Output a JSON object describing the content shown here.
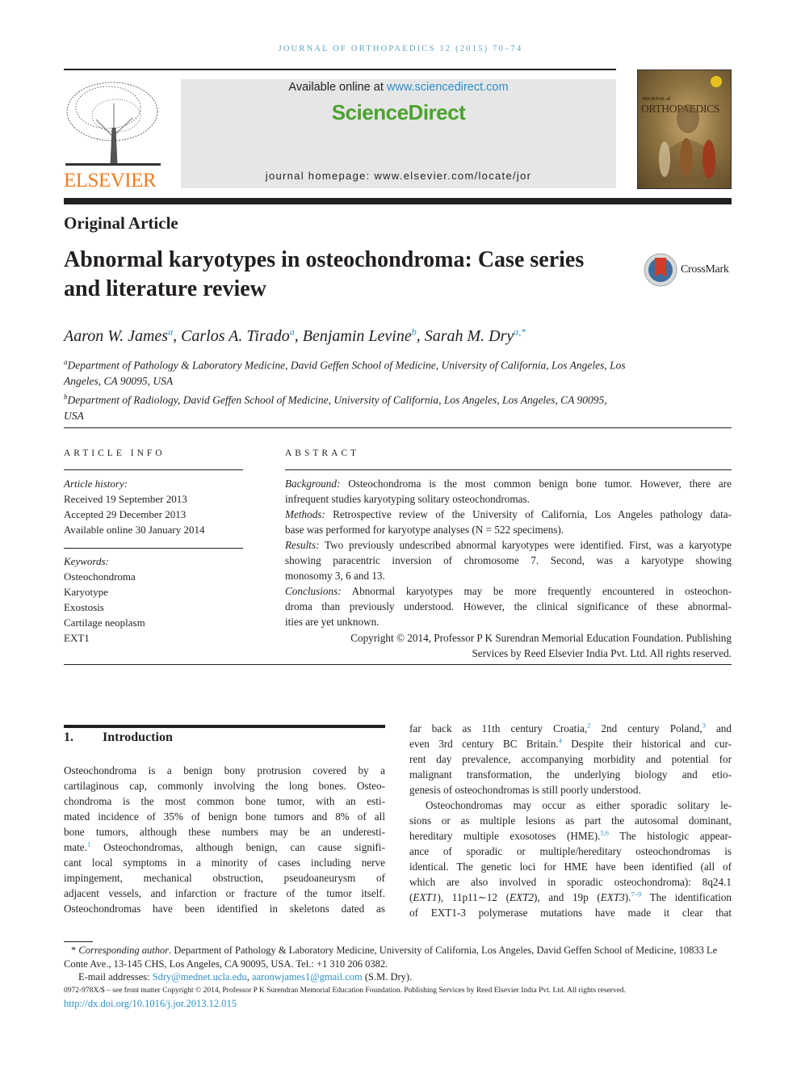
{
  "journal_header": "Journal of Orthopaedics 12 (2015) 70–74",
  "publisher_logo": {
    "text": "ELSEVIER",
    "color": "#f47b20",
    "icon": "elsevier-tree-icon"
  },
  "banner": {
    "available_prefix": "Available online at ",
    "available_link": "www.sciencedirect.com",
    "brand": "ScienceDirect",
    "brand_color": "#4aa32d",
    "homepage": "journal homepage: www.elsevier.com/locate/jor"
  },
  "cover": {
    "line1": "JOURNAL of",
    "line2": "ORTHOPAEDICS"
  },
  "article_type": "Original Article",
  "title": "Abnormal karyotypes in osteochondroma: Case series and literature review",
  "crossmark": "CrossMark",
  "authors": [
    {
      "name": "Aaron W. James",
      "sup": "a"
    },
    {
      "name": "Carlos A. Tirado",
      "sup": "a"
    },
    {
      "name": "Benjamin Levine",
      "sup": "b"
    },
    {
      "name": "Sarah M. Dry",
      "sup": "a,*"
    }
  ],
  "affiliations": [
    {
      "sup": "a",
      "text": "Department of Pathology & Laboratory Medicine, David Geffen School of Medicine, University of California, Los Angeles, Los Angeles, CA 90095, USA"
    },
    {
      "sup": "b",
      "text": "Department of Radiology, David Geffen School of Medicine, University of California, Los Angeles, Los Angeles, CA 90095, USA"
    }
  ],
  "article_info": {
    "heading": "Article info",
    "history_label": "Article history:",
    "history": [
      "Received 19 September 2013",
      "Accepted 29 December 2013",
      "Available online 30 January 2014"
    ],
    "keywords_label": "Keywords:",
    "keywords": [
      "Osteochondroma",
      "Karyotype",
      "Exostosis",
      "Cartilage neoplasm",
      "EXT1"
    ]
  },
  "abstract": {
    "heading": "Abstract",
    "paras": [
      [
        [
          {
            "i": "Background:"
          },
          " Osteochondroma is the most common benign bone tumor. However, there are"
        ],
        [
          "infrequent studies karyotyping solitary osteochondromas."
        ]
      ],
      [
        [
          {
            "i": "Methods:"
          },
          " Retrospective review of the University of California, Los Angeles pathology data-"
        ],
        [
          "base was performed for karyotype analyses (N = 522 specimens)."
        ]
      ],
      [
        [
          {
            "i": "Results:"
          },
          " Two previously undescribed abnormal karyotypes were identified. First, was a karyotype"
        ],
        [
          "showing paracentric inversion of chromosome 7. Second, was a karyotype showing"
        ],
        [
          "monosomy 3, 6 and 13."
        ]
      ],
      [
        [
          {
            "i": "Conclusions:"
          },
          " Abnormal karyotypes may be more frequently encountered in osteochon-"
        ],
        [
          "droma than previously understood. However, the clinical significance of these abnormal-"
        ],
        [
          "ities are yet unknown."
        ]
      ]
    ],
    "copyright": [
      "Copyright © 2014, Professor P K Surendran Memorial Education Foundation. Publishing",
      "Services by Reed Elsevier India Pvt. Ltd. All rights reserved."
    ]
  },
  "intro": {
    "number": "1.",
    "heading": "Introduction",
    "left": [
      [
        [
          "Osteochondroma is a benign bony protrusion covered by a"
        ],
        [
          "cartilaginous cap, commonly involving the long bones. Osteo-"
        ],
        [
          "chondroma is the most common bone tumor, with an esti-"
        ],
        [
          "mated incidence of 35% of benign bone tumors and 8% of all"
        ],
        [
          "bone tumors, although these numbers may be an underesti-"
        ],
        [
          "mate.",
          {
            "sup": "1"
          },
          " Osteochondromas, although benign, can cause signifi-"
        ],
        [
          "cant local symptoms in a minority of cases including nerve"
        ],
        [
          "impingement, mechanical obstruction, pseudoaneurysm of"
        ],
        [
          "adjacent vessels, and infarction or fracture of the tumor itself."
        ],
        [
          "Osteochondromas have been identified in skeletons dated as"
        ],
        {
          "cont": true
        }
      ]
    ],
    "right": [
      [
        [
          "far back as 11th century Croatia,",
          {
            "sup": "2"
          },
          " 2nd century Poland,",
          {
            "sup": "3"
          },
          " and"
        ],
        [
          "even 3rd century BC Britain.",
          {
            "sup": "4"
          },
          " Despite their historical and cur-"
        ],
        [
          "rent day prevalence, accompanying morbidity and potential for"
        ],
        [
          "malignant transformation, the underlying biology and etio-"
        ],
        [
          "genesis of osteochondromas is still poorly understood."
        ]
      ],
      [
        {
          "indent": true
        },
        [
          "Osteochondromas may occur as either sporadic solitary le-"
        ],
        [
          "sions or as multiple lesions as part the autosomal dominant,"
        ],
        [
          "hereditary multiple exosotoses (HME).",
          {
            "sup": "5,6"
          },
          " The histologic appear-"
        ],
        [
          "ance of sporadic or multiple/hereditary osteochondromas is"
        ],
        [
          "identical. The genetic loci for HME have been identified (all of"
        ],
        [
          "which are also involved in sporadic osteochondroma): 8q24.1"
        ],
        [
          "(",
          {
            "i": "EXT1"
          },
          "), 11p11∼12 (",
          {
            "i": "EXT2"
          },
          "), and 19p (",
          {
            "i": "EXT3"
          },
          ").",
          {
            "sup": "7–9"
          },
          " The identification"
        ],
        [
          "of EXT1-3 polymerase mutations have made it clear that"
        ],
        {
          "cont": true
        }
      ]
    ]
  },
  "footnote": {
    "star": "*",
    "label": "Corresponding author",
    "text": ". Department of Pathology & Laboratory Medicine, University of California, Los Angeles, David Geffen School of Medicine, 10833 Le Conte Ave., 13-145 CHS, Los Angeles, CA 90095, USA. Tel.: +1 310 206 0382.",
    "email_label": "E-mail addresses: ",
    "email1": "Sdry@mednet.ucla.edu",
    "email2": "aaronwjames1@gmail.com",
    "email_suffix": " (S.M. Dry).",
    "front_matter": "0972-978X/$ – see front matter Copyright © 2014, Professor P K Surendran Memorial Education Foundation. Publishing Services by Reed Elsevier India Pvt. Ltd. All rights reserved.",
    "doi": "http://dx.doi.org/10.1016/j.jor.2013.12.015"
  },
  "link_color": "#2f8fc6"
}
